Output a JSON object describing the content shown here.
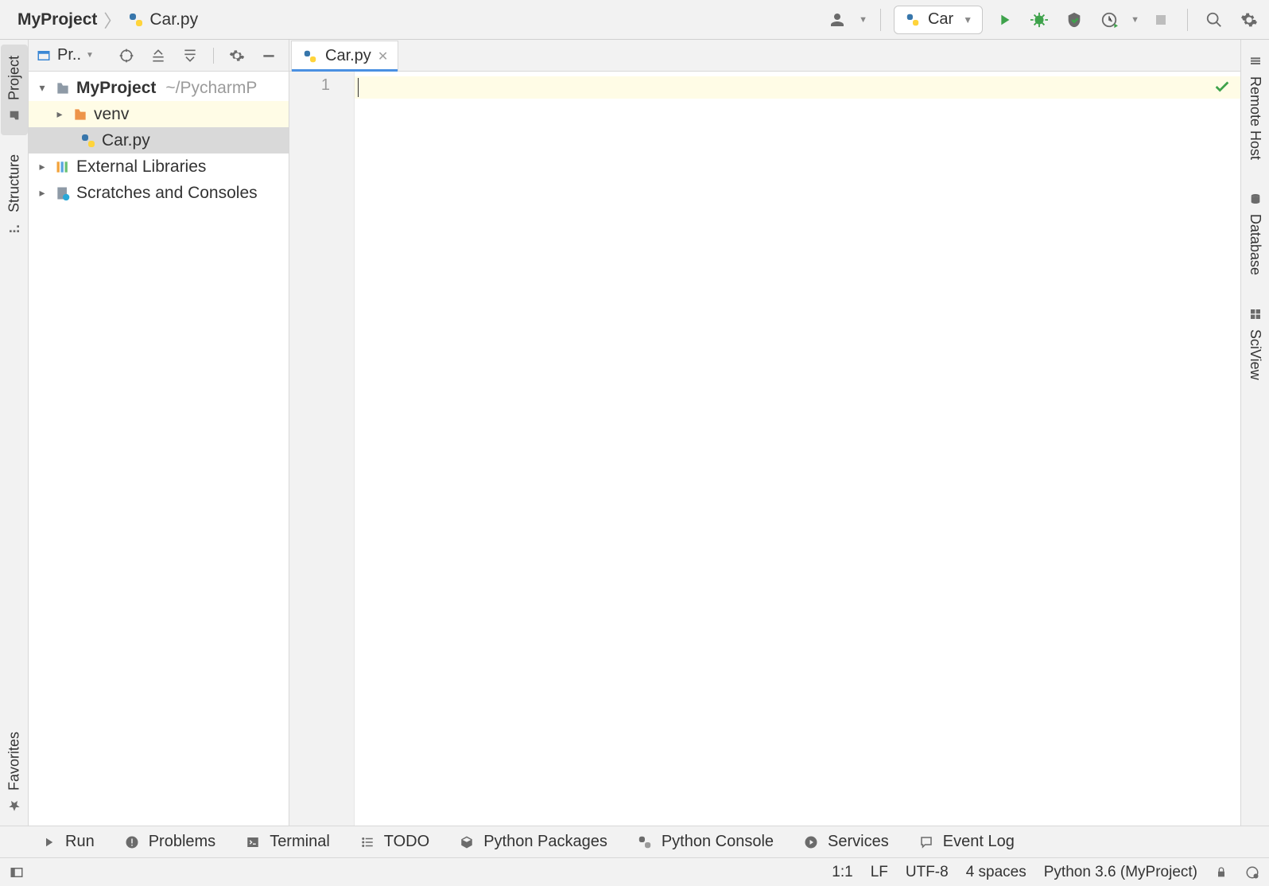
{
  "breadcrumb": {
    "project": "MyProject",
    "file": "Car.py"
  },
  "run_config": {
    "label": "Car"
  },
  "project_panel": {
    "title": "Pr..",
    "tree": {
      "root": {
        "label": "MyProject",
        "path": "~/PycharmP"
      },
      "venv": "venv",
      "file": "Car.py",
      "external": "External Libraries",
      "scratches": "Scratches and Consoles"
    }
  },
  "editor": {
    "tab_label": "Car.py",
    "line_numbers": [
      "1"
    ]
  },
  "left_tabs": {
    "project": "Project",
    "structure": "Structure",
    "favorites": "Favorites"
  },
  "right_tabs": {
    "remote": "Remote Host",
    "database": "Database",
    "sciview": "SciView"
  },
  "bottom_bar": {
    "run": "Run",
    "problems": "Problems",
    "terminal": "Terminal",
    "todo": "TODO",
    "packages": "Python Packages",
    "console": "Python Console",
    "services": "Services",
    "event_log": "Event Log"
  },
  "status_bar": {
    "caret": "1:1",
    "line_sep": "LF",
    "encoding": "UTF-8",
    "indent": "4 spaces",
    "interpreter": "Python 3.6 (MyProject)"
  }
}
